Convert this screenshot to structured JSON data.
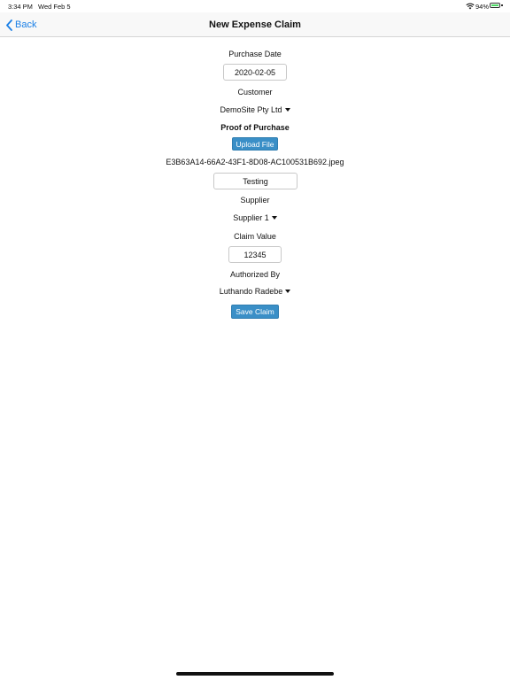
{
  "status_bar": {
    "time": "3:34 PM",
    "date": "Wed Feb 5",
    "battery_percent": "94%",
    "battery_level": 0.94,
    "icons": [
      "wifi-icon",
      "battery-icon"
    ]
  },
  "nav": {
    "back_label": "Back",
    "title": "New Expense Claim",
    "accent_color": "#1a7fe6"
  },
  "form": {
    "purchase_date_label": "Purchase Date",
    "purchase_date_value": "2020-02-05",
    "customer_label": "Customer",
    "customer_selected": "DemoSite Pty Ltd",
    "proof_label": "Proof of Purchase",
    "upload_button": "Upload File",
    "file_name": "E3B63A14-66A2-43F1-8D08-AC100531B692.jpeg",
    "description_value": "Testing",
    "supplier_label": "Supplier",
    "supplier_selected": "Supplier 1",
    "claim_value_label": "Claim Value",
    "claim_value": "12345",
    "authorized_label": "Authorized By",
    "authorized_selected": "Luthando Radebe",
    "save_button": "Save Claim",
    "button_color": "#3a8fc7"
  }
}
